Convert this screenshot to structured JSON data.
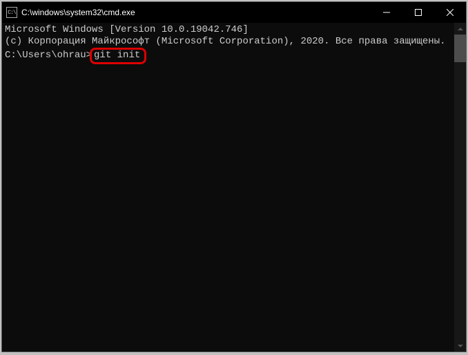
{
  "titlebar": {
    "icon_text": "C:\\",
    "title": "C:\\windows\\system32\\cmd.exe"
  },
  "terminal": {
    "line1": "Microsoft Windows [Version 10.0.19042.746]",
    "line2": "(c) Корпорация Майкрософт (Microsoft Corporation), 2020. Все права защищены.",
    "line3": "",
    "prompt": "C:\\Users\\ohrau>",
    "command": "git init"
  }
}
